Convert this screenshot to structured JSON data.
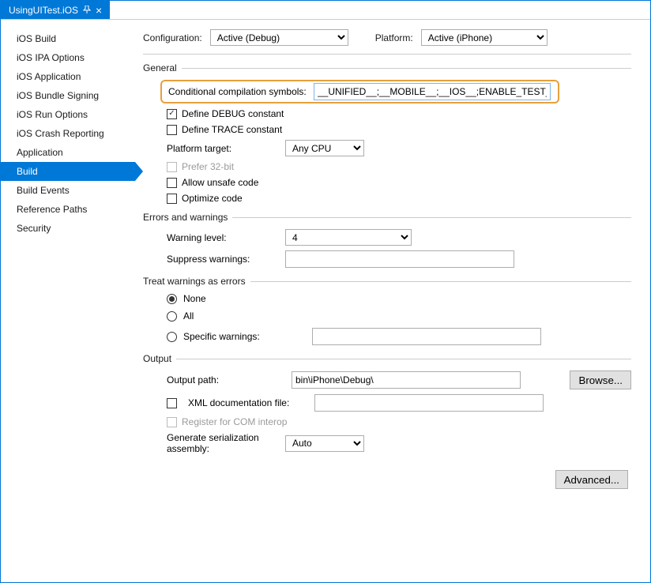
{
  "tab": {
    "title": "UsingUITest.iOS"
  },
  "sidebar": {
    "items": [
      {
        "label": "iOS Build"
      },
      {
        "label": "iOS IPA Options"
      },
      {
        "label": "iOS Application"
      },
      {
        "label": "iOS Bundle Signing"
      },
      {
        "label": "iOS Run Options"
      },
      {
        "label": "iOS Crash Reporting"
      },
      {
        "label": "Application"
      },
      {
        "label": "Build",
        "active": true
      },
      {
        "label": "Build Events"
      },
      {
        "label": "Reference Paths"
      },
      {
        "label": "Security"
      }
    ]
  },
  "toprow": {
    "config_label": "Configuration:",
    "config_value": "Active (Debug)",
    "platform_label": "Platform:",
    "platform_value": "Active (iPhone)"
  },
  "general": {
    "title": "General",
    "cond_label": "Conditional compilation symbols:",
    "cond_value": "__UNIFIED__;__MOBILE__;__IOS__;ENABLE_TEST_CLOUD;",
    "define_debug": "Define DEBUG constant",
    "define_trace": "Define TRACE constant",
    "platform_target_label": "Platform target:",
    "platform_target_value": "Any CPU",
    "prefer32": "Prefer 32-bit",
    "allow_unsafe": "Allow unsafe code",
    "optimize": "Optimize code"
  },
  "errors": {
    "title": "Errors and warnings",
    "warn_level_label": "Warning level:",
    "warn_level_value": "4",
    "suppress_label": "Suppress warnings:",
    "suppress_value": ""
  },
  "treat": {
    "title": "Treat warnings as errors",
    "none": "None",
    "all": "All",
    "specific": "Specific warnings:",
    "specific_value": ""
  },
  "output": {
    "title": "Output",
    "path_label": "Output path:",
    "path_value": "bin\\iPhone\\Debug\\",
    "browse": "Browse...",
    "xml_doc": "XML documentation file:",
    "xml_doc_value": "",
    "register_com": "Register for COM interop",
    "serialization_label": "Generate serialization assembly:",
    "serialization_value": "Auto"
  },
  "advanced": "Advanced..."
}
